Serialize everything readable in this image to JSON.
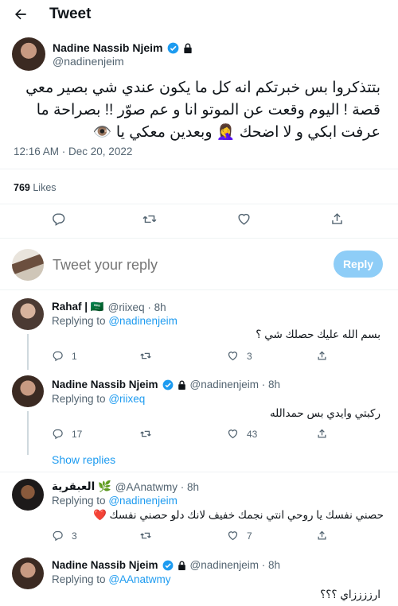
{
  "header": {
    "title": "Tweet",
    "back_icon": "arrow-left-icon"
  },
  "main_tweet": {
    "author_name": "Nadine Nassib Njeim",
    "author_handle": "@nadinenjeim",
    "text_line1": "بتتذكروا بس خبرتكم انه كل ما يكون عندي شي بصير معي",
    "text_line2": "قصة ! اليوم وقعت عن الموتو انا و عم صوّر !! بصراحة ما",
    "text_line3": "عرفت ابكي و لا اضحك 🤦‍♀️ وبعدين معكي يا 👁️",
    "timestamp": "12:16 AM · Dec 20, 2022",
    "likes_count": "769",
    "likes_label": "Likes"
  },
  "composer": {
    "placeholder": "Tweet your reply",
    "reply_button": "Reply"
  },
  "replies": [
    {
      "name": "Rahaf | 🇸🇦",
      "handle": "@riixeq · 8h",
      "replying_prefix": "Replying to",
      "replying_to": "@nadinenjeim",
      "text": "بسم الله عليك حصلك شي ؟",
      "reply_count": "1",
      "retweet_count": "",
      "like_count": "3"
    },
    {
      "name": "Nadine Nassib Njeim",
      "handle": "@nadinenjeim · 8h",
      "replying_prefix": "Replying to",
      "replying_to": "@riixeq",
      "text": "ركبتي وايدي بس حمدالله",
      "reply_count": "17",
      "retweet_count": "",
      "like_count": "43",
      "show_replies": "Show replies"
    },
    {
      "name": "العبقرية 🌿",
      "handle": "@AAnatwmy · 8h",
      "replying_prefix": "Replying to",
      "replying_to": "@nadinenjeim",
      "text": "حصني نفسك يا روحي انتي نجمك خفيف لانك دلو حصني نفسك ❤️",
      "reply_count": "3",
      "retweet_count": "",
      "like_count": "7"
    },
    {
      "name": "Nadine Nassib Njeim",
      "handle": "@nadinenjeim · 8h",
      "replying_prefix": "Replying to",
      "replying_to": "@AAnatwmy",
      "text": "ارززززاي ؟؟؟"
    }
  ],
  "colors": {
    "accent": "#1d9bf0",
    "muted": "#536471",
    "reply_button_disabled": "#8ecdf7",
    "verified": "#1d9bf0"
  }
}
